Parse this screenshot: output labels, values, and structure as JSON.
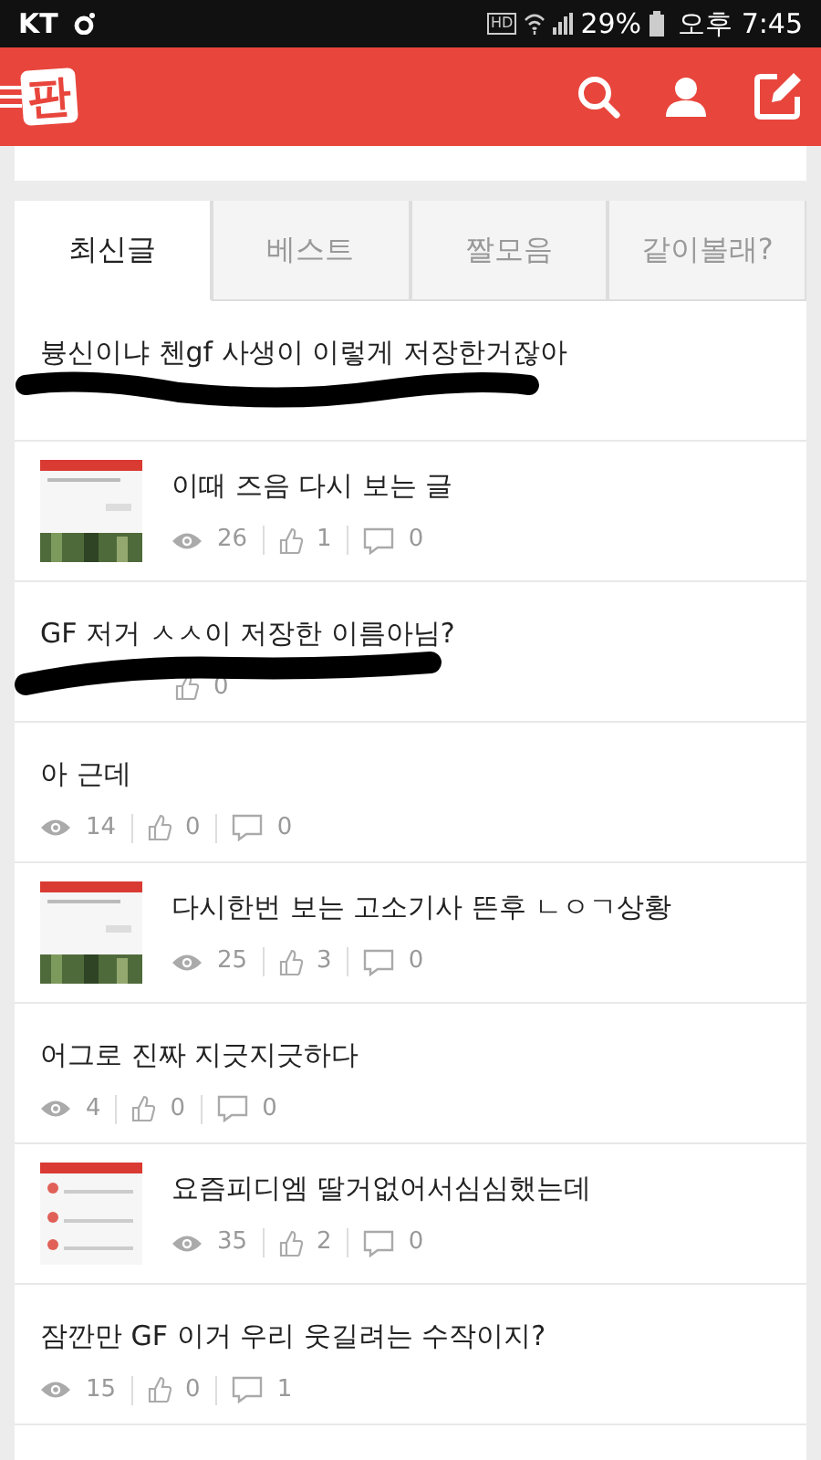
{
  "status_bar": {
    "carrier": "KT",
    "hd": "HD",
    "battery": "29%",
    "time": "오후 7:45"
  },
  "app_bar": {
    "logo": "판"
  },
  "tabs": [
    {
      "label": "최신글",
      "selected": true
    },
    {
      "label": "베스트",
      "selected": false
    },
    {
      "label": "짤모음",
      "selected": false
    },
    {
      "label": "같이볼래?",
      "selected": false
    }
  ],
  "posts": [
    {
      "kind": "text",
      "title": "븅신이냐 첸gf 사생이 이렇게 저장한거잖아",
      "redacted": true
    },
    {
      "kind": "thumbnail",
      "title": "이때 즈음 다시 보는 글",
      "views": "26",
      "likes": "1",
      "comments": "0",
      "redacted": false
    },
    {
      "kind": "text",
      "title": "GF 저거 ㅅㅅ이 저장한 이름아님?",
      "likes": "0",
      "redacted": true
    },
    {
      "kind": "text",
      "title": "아 근데",
      "views": "14",
      "likes": "0",
      "comments": "0",
      "redacted": false
    },
    {
      "kind": "thumbnail",
      "title": "다시한번 보는 고소기사 뜬후 ㄴㅇㄱ상황",
      "views": "25",
      "likes": "3",
      "comments": "0",
      "redacted": false
    },
    {
      "kind": "text",
      "title": "어그로 진짜 지긋지긋하다",
      "views": "4",
      "likes": "0",
      "comments": "0",
      "redacted": false
    },
    {
      "kind": "thumbnail",
      "title": "요즘피디엠 딸거없어서심심했는데",
      "views": "35",
      "likes": "2",
      "comments": "0",
      "redacted": false
    },
    {
      "kind": "text",
      "title": "잠깐만 GF 이거 우리 웃길려는 수작이지?",
      "views": "15",
      "likes": "0",
      "comments": "1",
      "redacted": false
    }
  ]
}
